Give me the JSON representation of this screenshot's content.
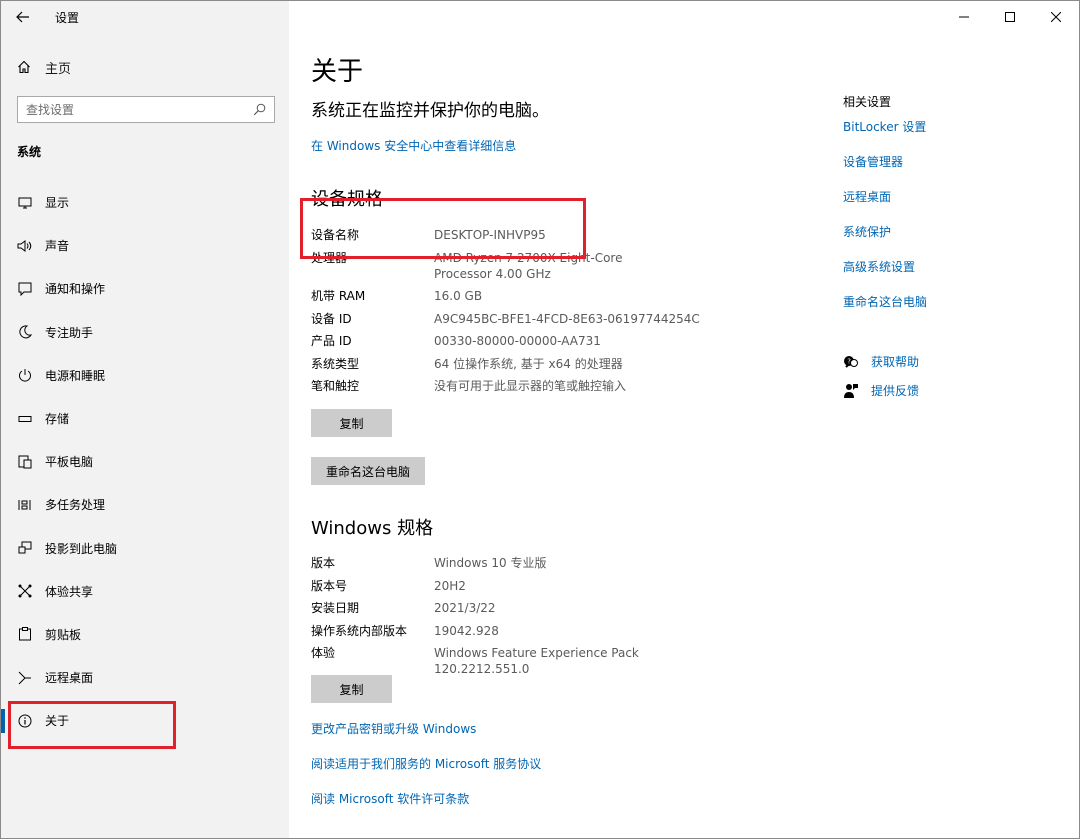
{
  "window": {
    "title": "设置"
  },
  "sidebar": {
    "home_label": "主页",
    "search_placeholder": "查找设置",
    "section": "系统",
    "items": [
      {
        "label": "显示",
        "icon": "monitor-icon"
      },
      {
        "label": "声音",
        "icon": "speaker-icon"
      },
      {
        "label": "通知和操作",
        "icon": "message-icon"
      },
      {
        "label": "专注助手",
        "icon": "moon-icon"
      },
      {
        "label": "电源和睡眠",
        "icon": "power-icon"
      },
      {
        "label": "存储",
        "icon": "storage-icon"
      },
      {
        "label": "平板电脑",
        "icon": "tablet-icon"
      },
      {
        "label": "多任务处理",
        "icon": "multitask-icon"
      },
      {
        "label": "投影到此电脑",
        "icon": "project-icon"
      },
      {
        "label": "体验共享",
        "icon": "share-icon"
      },
      {
        "label": "剪贴板",
        "icon": "clipboard-icon"
      },
      {
        "label": "远程桌面",
        "icon": "remote-icon"
      },
      {
        "label": "关于",
        "icon": "info-icon",
        "active": true
      }
    ]
  },
  "main": {
    "title": "关于",
    "protect_text": "系统正在监控并保护你的电脑。",
    "security_link": "在 Windows 安全中心中查看详细信息",
    "device_specs_title": "设备规格",
    "device_specs": [
      {
        "k": "设备名称",
        "v": "DESKTOP-INHVP95"
      },
      {
        "k": "处理器",
        "v": "AMD Ryzen 7 2700X Eight-Core Processor 4.00 GHz"
      },
      {
        "k": "机带 RAM",
        "v": "16.0 GB"
      },
      {
        "k": "设备 ID",
        "v": "A9C945BC-BFE1-4FCD-8E63-06197744254C"
      },
      {
        "k": "产品 ID",
        "v": "00330-80000-00000-AA731"
      },
      {
        "k": "系统类型",
        "v": "64 位操作系统, 基于 x64 的处理器"
      },
      {
        "k": "笔和触控",
        "v": "没有可用于此显示器的笔或触控输入"
      }
    ],
    "copy_label": "复制",
    "rename_label": "重命名这台电脑",
    "windows_specs_title": "Windows 规格",
    "windows_specs": [
      {
        "k": "版本",
        "v": "Windows 10 专业版"
      },
      {
        "k": "版本号",
        "v": "20H2"
      },
      {
        "k": "安装日期",
        "v": "2021/3/22"
      },
      {
        "k": "操作系统内部版本",
        "v": "19042.928"
      },
      {
        "k": "体验",
        "v": "Windows Feature Experience Pack 120.2212.551.0"
      }
    ],
    "copy2_label": "复制",
    "link_upgrade": "更改产品密钥或升级 Windows",
    "link_msa": "阅读适用于我们服务的 Microsoft 服务协议",
    "link_license": "阅读 Microsoft 软件许可条款"
  },
  "related": {
    "title": "相关设置",
    "links": [
      "BitLocker 设置",
      "设备管理器",
      "远程桌面",
      "系统保护",
      "高级系统设置",
      "重命名这台电脑"
    ]
  },
  "help": {
    "get_help": "获取帮助",
    "feedback": "提供反馈"
  },
  "colors": {
    "accent": "#0063b1",
    "link": "#0066b4",
    "highlight": "#e0202a",
    "button": "#cccccc"
  }
}
